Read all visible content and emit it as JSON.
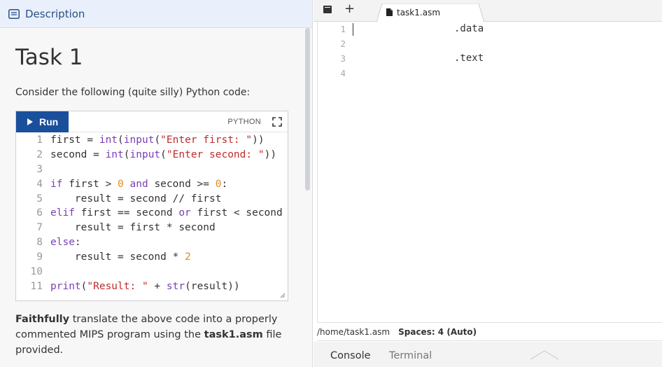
{
  "description_panel": {
    "header": "Description",
    "task_title": "Task 1",
    "intro": "Consider the following (quite silly) Python code:",
    "code_block": {
      "run_label": "Run",
      "language": "PYTHON",
      "lines": [
        {
          "n": "1",
          "html": "first = <span class='bi'>int</span>(<span class='bi'>input</span>(<span class='st'>\"Enter first: \"</span>))"
        },
        {
          "n": "2",
          "html": "second = <span class='bi'>int</span>(<span class='bi'>input</span>(<span class='st'>\"Enter second: \"</span>))"
        },
        {
          "n": "3",
          "html": ""
        },
        {
          "n": "4",
          "html": "<span class='kw'>if</span> first &gt; <span class='nm'>0</span> <span class='kw'>and</span> second &gt;= <span class='nm'>0</span>:"
        },
        {
          "n": "5",
          "html": "    result = second // first"
        },
        {
          "n": "6",
          "html": "<span class='kw'>elif</span> first == second <span class='kw'>or</span> first &lt; second"
        },
        {
          "n": "7",
          "html": "    result = first * second"
        },
        {
          "n": "8",
          "html": "<span class='kw'>else</span>:"
        },
        {
          "n": "9",
          "html": "    result = second * <span class='nm'>2</span>"
        },
        {
          "n": "10",
          "html": ""
        },
        {
          "n": "11",
          "html": "<span class='bi'>print</span>(<span class='st'>\"Result: \"</span> + <span class='bi'>str</span>(result))"
        }
      ]
    },
    "instruction": {
      "bold1": "Faithfully",
      "text1": " translate the above code into a properly commented MIPS program using the ",
      "bold2": "task1.asm",
      "text2": " file provided."
    }
  },
  "editor": {
    "tab_label": "task1.asm",
    "lines": [
      {
        "n": "1",
        "text": ".data"
      },
      {
        "n": "2",
        "text": ""
      },
      {
        "n": "3",
        "text": ".text"
      },
      {
        "n": "4",
        "text": ""
      }
    ],
    "status": {
      "path": "/home/task1.asm",
      "spaces": "Spaces: 4 (Auto)"
    }
  },
  "bottom_tabs": {
    "console": "Console",
    "terminal": "Terminal"
  },
  "colors": {
    "run_button": "#1a4f9b",
    "header_bg": "#e9f0fb",
    "header_text": "#2b4f86"
  }
}
